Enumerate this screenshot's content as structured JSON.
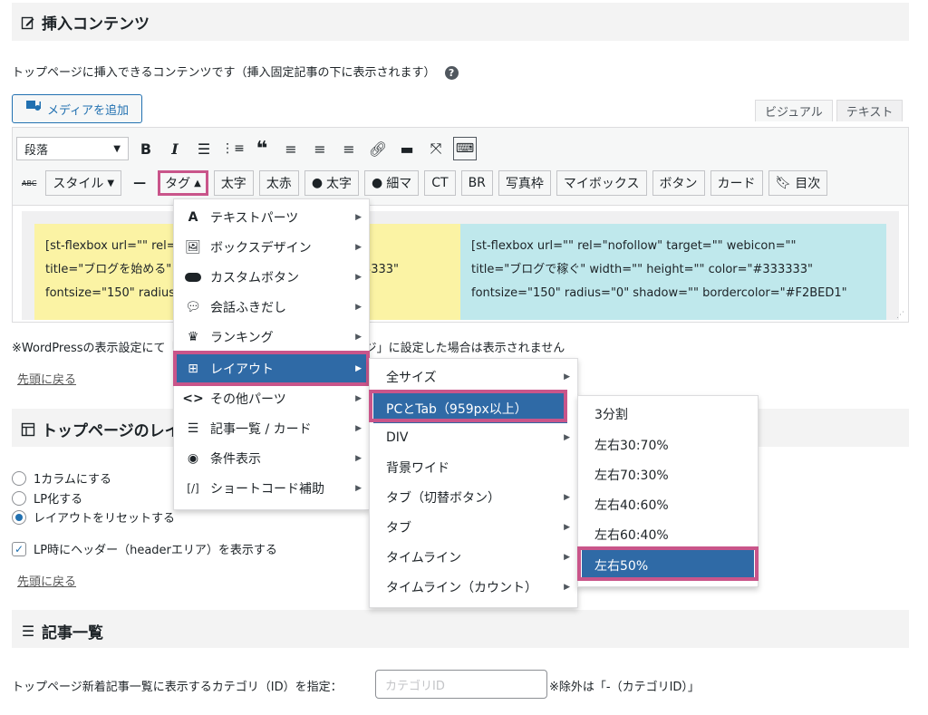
{
  "section_insert": {
    "title": "挿入コンテンツ",
    "icon": "edit-icon"
  },
  "insert_desc": "トップページに挿入できるコンテンツです（挿入固定記事の下に表示されます）",
  "media_button": "メディアを追加",
  "editor_tabs": [
    "ビジュアル",
    "テキスト"
  ],
  "toolbar": {
    "format_select": "段落",
    "row2": {
      "style_label": "スタイル",
      "tag_label": "タグ",
      "btn_taiji": "太字",
      "btn_akaji": "太赤",
      "btn_person_taiji": "太字",
      "btn_person_hosoma": "細マ",
      "btn_ct": "CT",
      "btn_br": "BR",
      "btn_photo": "写真枠",
      "btn_mybox": "マイボックス",
      "btn_button": "ボタン",
      "btn_card": "カード",
      "btn_toc": "目次"
    }
  },
  "content_blocks": {
    "left": [
      "[st-flexbox url=\"\" rel=\"nofollow\" target=\"\" webicon=\"\"",
      "title=\"ブログを始める\" width=\"\" height=\"\" color=\"#333333\"",
      "fontsize=\"150\" radius=\"0\" shadow=\"\" bordercolor=\"\""
    ],
    "right": [
      "[st-flexbox url=\"\" rel=\"nofollow\" target=\"\" webicon=\"\"",
      "title=\"ブログで稼ぐ\" width=\"\" height=\"\" color=\"#333333\"",
      "fontsize=\"150\" radius=\"0\" shadow=\"\" bordercolor=\"#F2BED1\""
    ]
  },
  "wp_note": "※WordPressの表示設定にて「ホームページの表示」を「固定ページ」に設定した場合は表示されません",
  "back_to_top": "先頭に戻る",
  "section_layout": {
    "title": "トップページのレイアウト",
    "icon": "layout-icon"
  },
  "layout_options": [
    "1カラムにする",
    "LP化する",
    "レイアウトをリセットする"
  ],
  "lp_header_option": "LP時にヘッダー（headerエリア）を表示する",
  "section_posts": {
    "title": "記事一覧",
    "icon": "list-icon"
  },
  "category_label": "トップページ新着記事一覧に表示するカテゴリ（ID）を指定：",
  "category_placeholder": "カテゴリID",
  "category_note": "※除外は「-（カテゴリID）」",
  "tag_menu": [
    {
      "label": "テキストパーツ",
      "icon": "text-icon"
    },
    {
      "label": "ボックスデザイン",
      "icon": "box-icon"
    },
    {
      "label": "カスタムボタン",
      "icon": "toggle-icon"
    },
    {
      "label": "会話ふきだし",
      "icon": "speech-icon"
    },
    {
      "label": "ランキング",
      "icon": "crown-icon"
    },
    {
      "label": "レイアウト",
      "icon": "grid-icon"
    },
    {
      "label": "その他パーツ",
      "icon": "code-icon"
    },
    {
      "label": "記事一覧 / カード",
      "icon": "list-icon"
    },
    {
      "label": "条件表示",
      "icon": "eye-icon"
    },
    {
      "label": "ショートコード補助",
      "icon": "bracket-icon"
    }
  ],
  "layout_menu": [
    "全サイズ",
    "PCとTab（959px以上）",
    "DIV",
    "背景ワイド",
    "タブ（切替ボタン）",
    "タブ",
    "タイムライン",
    "タイムライン（カウント）"
  ],
  "pc_menu": [
    "3分割",
    "左右30:70%",
    "左右70:30%",
    "左右40:60%",
    "左右60:40%",
    "左右50%"
  ],
  "colors": {
    "highlight": "#c9558a",
    "selected": "#2f6aa6"
  }
}
